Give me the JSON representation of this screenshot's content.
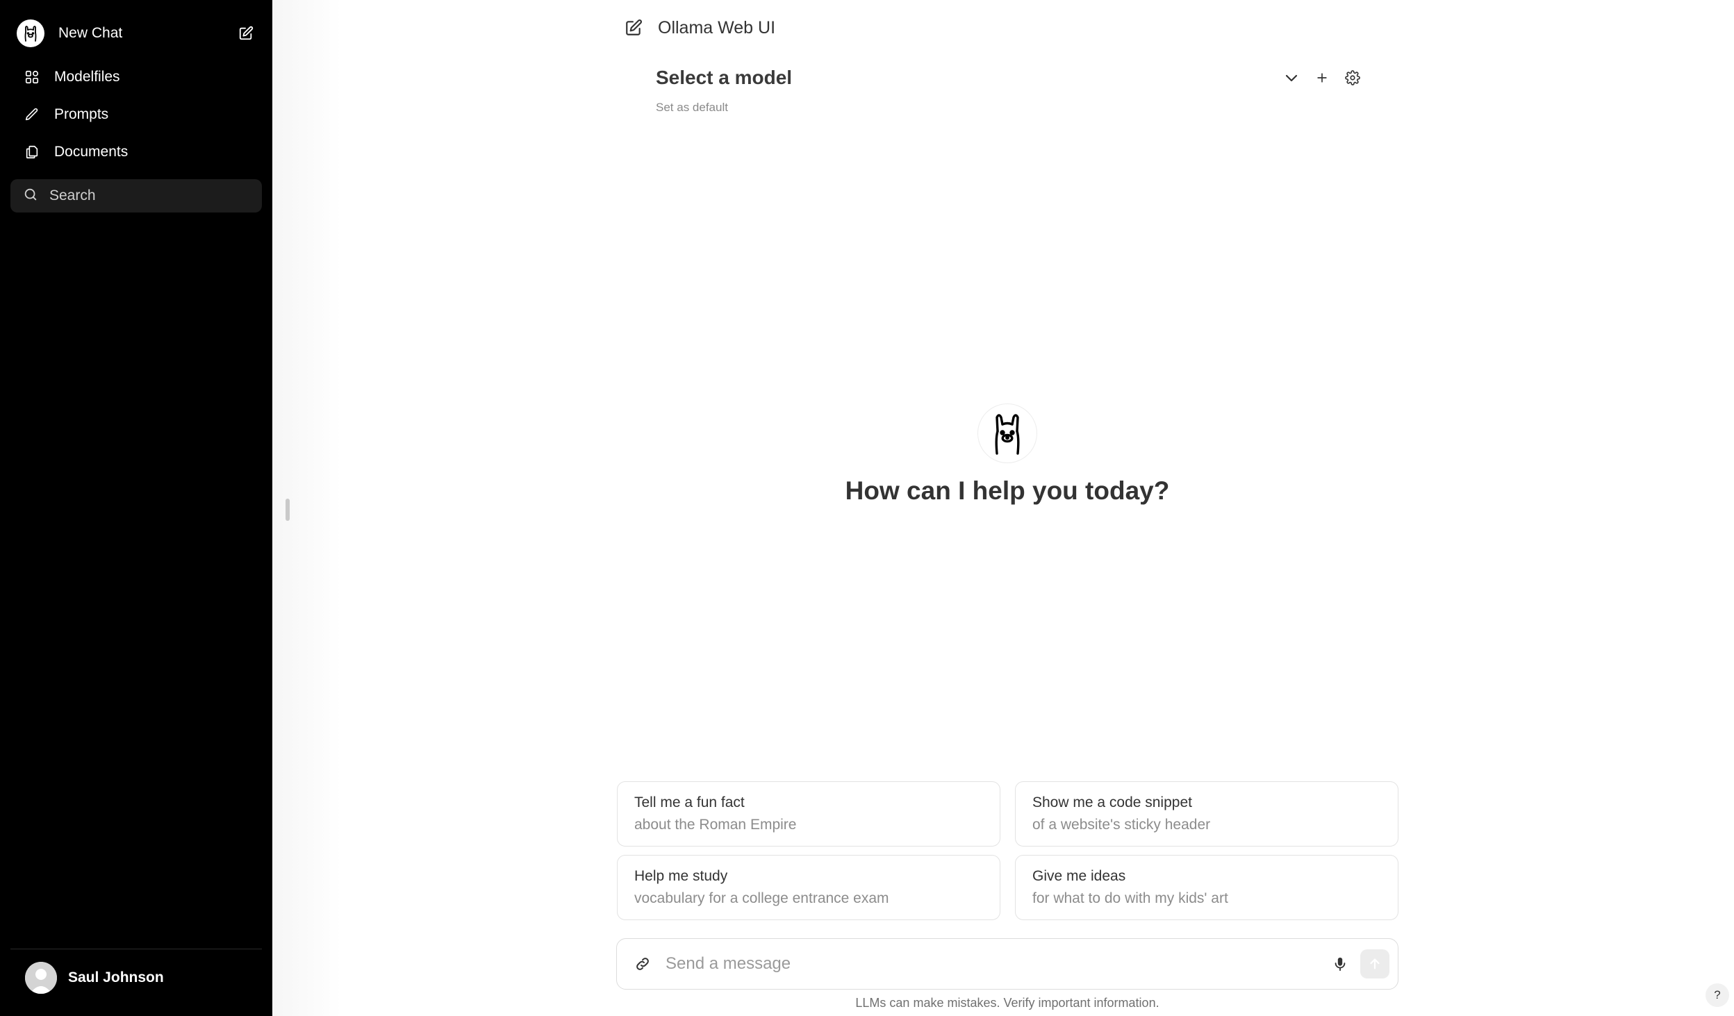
{
  "sidebar": {
    "new_chat_label": "New Chat",
    "items": [
      {
        "label": "Modelfiles",
        "icon": "grid-icon"
      },
      {
        "label": "Prompts",
        "icon": "pencil-icon"
      },
      {
        "label": "Documents",
        "icon": "documents-icon"
      }
    ],
    "search_placeholder": "Search",
    "user_name": "Saul Johnson"
  },
  "header": {
    "title": "Ollama Web UI"
  },
  "model_selector": {
    "label": "Select a model",
    "set_default": "Set as default"
  },
  "hero": {
    "greeting": "How can I help you today?"
  },
  "suggestions": [
    {
      "title": "Tell me a fun fact",
      "subtitle": "about the Roman Empire"
    },
    {
      "title": "Show me a code snippet",
      "subtitle": "of a website's sticky header"
    },
    {
      "title": "Help me study",
      "subtitle": "vocabulary for a college entrance exam"
    },
    {
      "title": "Give me ideas",
      "subtitle": "for what to do with my kids' art"
    }
  ],
  "composer": {
    "placeholder": "Send a message"
  },
  "footer": {
    "disclaimer": "LLMs can make mistakes. Verify important information.",
    "help_label": "?"
  },
  "colors": {
    "sidebar_bg": "#000000",
    "search_bg": "#1c1c1c",
    "send_button_bg": "#ececec"
  }
}
